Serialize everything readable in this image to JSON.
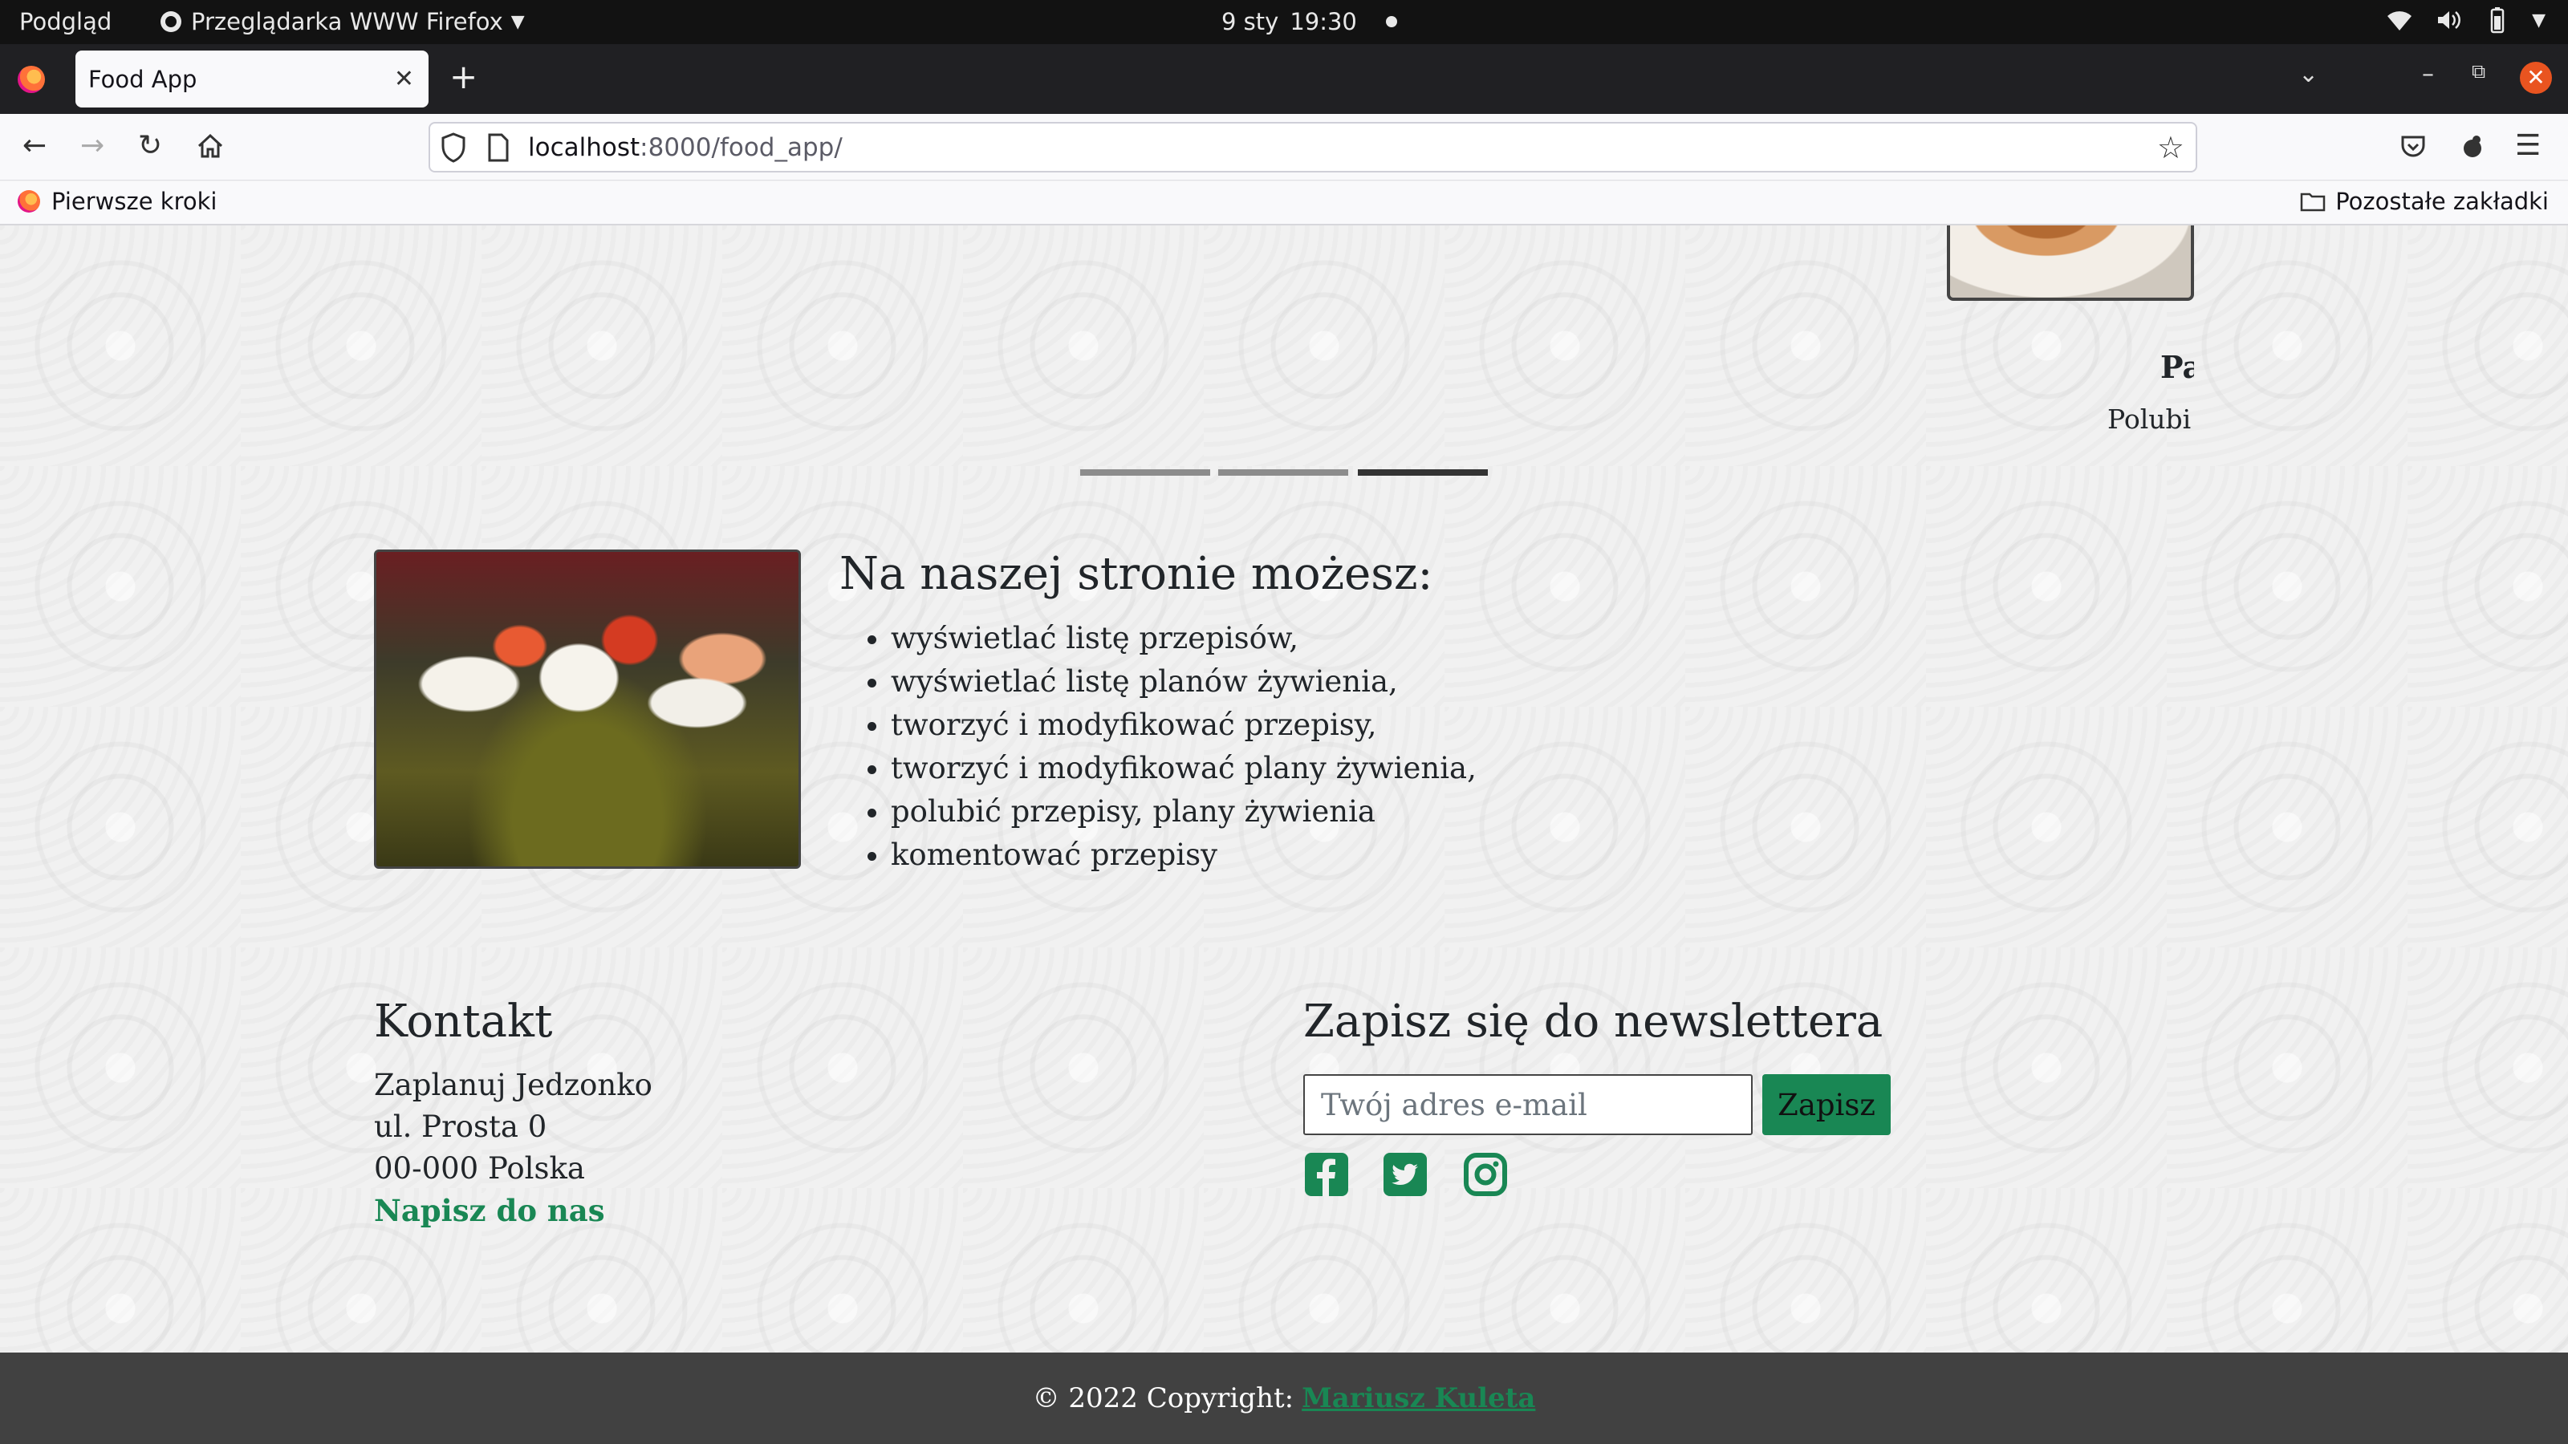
{
  "os": {
    "activities": "Podgląd",
    "app_menu": "Przeglądarka WWW Firefox",
    "date": "9 sty",
    "time": "19:30"
  },
  "browser": {
    "tab_title": "Food App",
    "url_host": "localhost",
    "url_path": ":8000/food_app/",
    "bookmark_first": "Pierwsze kroki",
    "bookmark_other": "Pozostałe zakładki"
  },
  "carousel": {
    "title_partial": "Pa",
    "subtitle_partial": "Polubi",
    "active_index": 2,
    "slide_count": 3
  },
  "features": {
    "heading": "Na naszej stronie możesz:",
    "items": [
      "wyświetlać listę przepisów,",
      "wyświetlać listę planów żywienia,",
      "tworzyć i modyfikować przepisy,",
      "tworzyć i modyfikować plany żywienia,",
      "polubić przepisy, plany żywienia",
      "komentować przepisy"
    ]
  },
  "contact": {
    "heading": "Kontakt",
    "lines": [
      "Zaplanuj Jedzonko",
      "ul. Prosta 0",
      "00-000 Polska"
    ],
    "link": "Napisz do nas"
  },
  "newsletter": {
    "heading": "Zapisz się do newslettera",
    "placeholder": "Twój adres e-mail",
    "button": "Zapisz",
    "social_icons": [
      "facebook-icon",
      "twitter-icon",
      "instagram-icon"
    ]
  },
  "footer": {
    "copyright": "© 2022 Copyright:",
    "author": "Mariusz Kuleta"
  },
  "colors": {
    "accent": "#198754",
    "footer_bg": "#414141",
    "os_bar": "#121212",
    "close_button": "#e95420"
  }
}
